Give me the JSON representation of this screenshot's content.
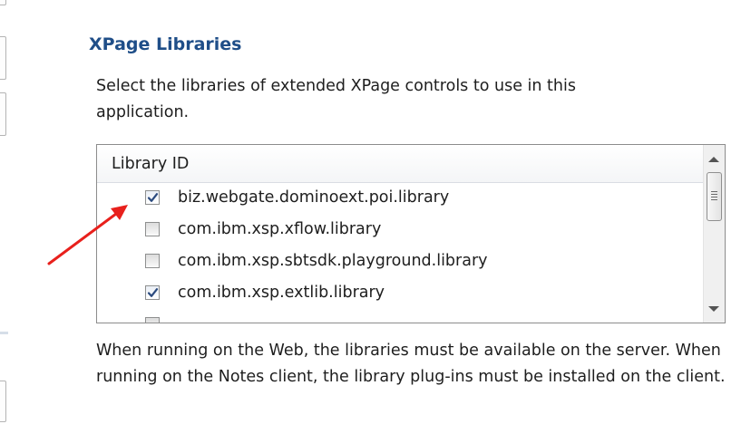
{
  "section": {
    "title": "XPage Libraries",
    "description": "Select the libraries of extended XPage controls to use in this application."
  },
  "library_table": {
    "column_header": "Library ID",
    "rows": [
      {
        "name": "biz.webgate.dominoext.poi.library",
        "checked": true
      },
      {
        "name": "com.ibm.xsp.xflow.library",
        "checked": false
      },
      {
        "name": "com.ibm.xsp.sbtsdk.playground.library",
        "checked": false
      },
      {
        "name": "com.ibm.xsp.extlib.library",
        "checked": true
      }
    ]
  },
  "footer_note": "When running on the Web, the libraries must be available on the server. When running on the Notes client, the library plug-ins must be installed on the client.",
  "icons": {
    "checkbox_checked": "check-mark-icon",
    "scroll_up": "triangle-up-icon",
    "scroll_down": "triangle-down-icon",
    "annotation": "red-arrow-icon"
  },
  "colors": {
    "title": "#1f4e88",
    "check_mark": "#2b4a7e",
    "annotation_arrow": "#e8201c"
  }
}
